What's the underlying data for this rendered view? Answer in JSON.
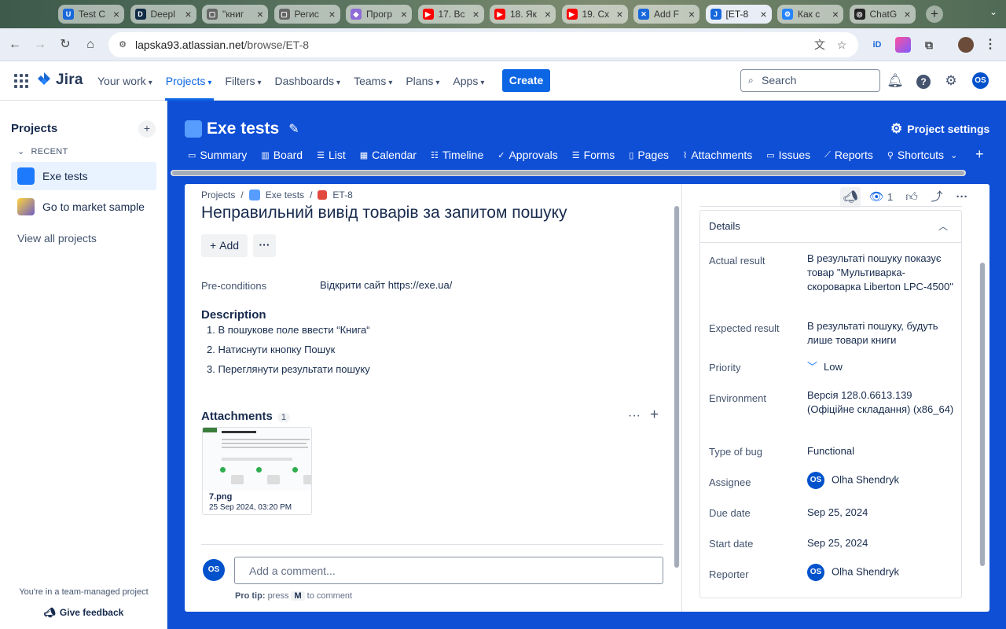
{
  "browser": {
    "tabs": [
      {
        "title": "Test C",
        "icon": "U",
        "color": "#1868db"
      },
      {
        "title": "Deepl",
        "icon": "D",
        "color": "#0f2b46"
      },
      {
        "title": "\"книг",
        "icon": "▢",
        "color": "#666666"
      },
      {
        "title": "Регис",
        "icon": "▢",
        "color": "#666666"
      },
      {
        "title": "Прогр",
        "icon": "◆",
        "color": "#8e6bd8"
      },
      {
        "title": "17. Вс",
        "icon": "▶",
        "color": "#ff0000"
      },
      {
        "title": "18. Як",
        "icon": "▶",
        "color": "#ff0000"
      },
      {
        "title": "19. Сх",
        "icon": "▶",
        "color": "#ff0000"
      },
      {
        "title": "Add F",
        "icon": "✕",
        "color": "#1868db"
      },
      {
        "title": "[ET-8",
        "icon": "J",
        "color": "#1868db"
      },
      {
        "title": "Как с",
        "icon": "⚙",
        "color": "#2684ff"
      },
      {
        "title": "ChatG",
        "icon": "◎",
        "color": "#222222"
      }
    ],
    "active_tab": 9,
    "url_host": "lapska93.atlassian.net",
    "url_path": "/browse/ET-8"
  },
  "topnav": {
    "product": "Jira",
    "items": [
      {
        "label": "Your work"
      },
      {
        "label": "Projects"
      },
      {
        "label": "Filters"
      },
      {
        "label": "Dashboards"
      },
      {
        "label": "Teams"
      },
      {
        "label": "Plans"
      },
      {
        "label": "Apps"
      }
    ],
    "create_label": "Create",
    "search_placeholder": "Search",
    "user_initials": "OS"
  },
  "sidebar": {
    "title": "Projects",
    "recent_label": "RECENT",
    "projects": [
      {
        "name": "Exe tests"
      },
      {
        "name": "Go to market sample"
      }
    ],
    "view_all": "View all projects",
    "team_note": "You're in a team-managed project",
    "feedback": "Give feedback"
  },
  "project": {
    "name": "Exe tests",
    "settings_label": "Project settings",
    "tabs": [
      {
        "label": "Summary",
        "icon": "▭"
      },
      {
        "label": "Board",
        "icon": "▥"
      },
      {
        "label": "List",
        "icon": "☰"
      },
      {
        "label": "Calendar",
        "icon": "▦"
      },
      {
        "label": "Timeline",
        "icon": "☷"
      },
      {
        "label": "Approvals",
        "icon": "✓"
      },
      {
        "label": "Forms",
        "icon": "☰"
      },
      {
        "label": "Pages",
        "icon": "▯"
      },
      {
        "label": "Attachments",
        "icon": "⌇"
      },
      {
        "label": "Issues",
        "icon": "▭"
      },
      {
        "label": "Reports",
        "icon": "⟋"
      },
      {
        "label": "Shortcuts",
        "icon": "⚲"
      }
    ]
  },
  "issue": {
    "breadcrumb": {
      "root": "Projects",
      "project": "Exe tests",
      "key": "ET-8"
    },
    "title": "Неправильний вивід товарів за запитом пошуку",
    "add_label": "Add",
    "preconditions_label": "Pre-conditions",
    "preconditions_value": "Відкрити сайт https://exe.ua/",
    "description_heading": "Description",
    "steps": [
      "1. В пошукове поле ввести “Книга“",
      "2. Натиснути кнопку Пошук",
      "3. Переглянути результати пошуку"
    ],
    "attachments_heading": "Attachments",
    "attachments_count": "1",
    "attachment": {
      "name": "7.png",
      "date": "25 Sep 2024, 03:20 PM"
    },
    "comment_placeholder": "Add a comment...",
    "protip_prefix": "Pro tip:",
    "protip_press": "press",
    "protip_key": "M",
    "protip_suffix": "to comment",
    "watchers": "1"
  },
  "details": {
    "heading": "Details",
    "actual_label": "Actual result",
    "actual_value": "В результаті пошуку показує товар \"Мультиварка-скороварка Liberton LPC-4500\"",
    "expected_label": "Expected result",
    "expected_value": "В результаті пошуку, будуть лише товари книги",
    "priority_label": "Priority",
    "priority_value": "Low",
    "environment_label": "Environment",
    "environment_value": "Версія 128.0.6613.139 (Офіційне складання) (x86_64)",
    "bugtype_label": "Type of bug",
    "bugtype_value": "Functional",
    "assignee_label": "Assignee",
    "assignee_value": "Olha Shendryk",
    "due_label": "Due date",
    "due_value": "Sep 25, 2024",
    "start_label": "Start date",
    "start_value": "Sep 25, 2024",
    "reporter_label": "Reporter",
    "reporter_value": "Olha Shendryk",
    "user_initials": "OS"
  },
  "colors": {
    "brand_blue": "#0c66e4",
    "project_bg": "#0f4fd6",
    "bug_red": "#e2483d"
  }
}
